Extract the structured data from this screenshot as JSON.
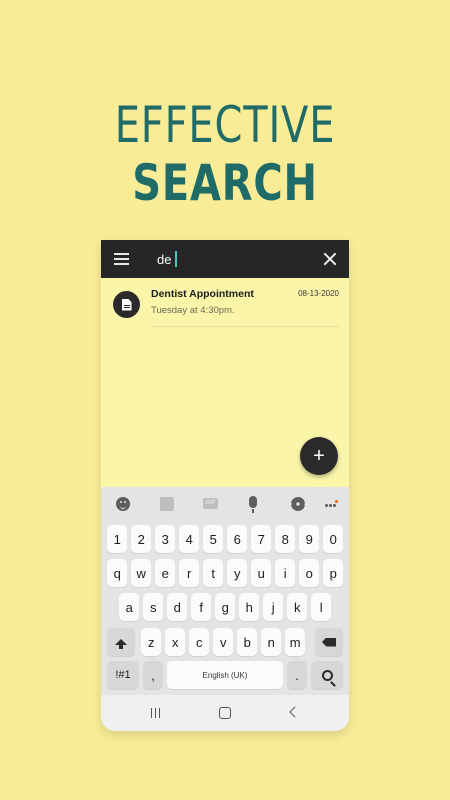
{
  "headline": {
    "line1": "EFFECTIVE",
    "line2": "SEARCH"
  },
  "search": {
    "value": "de",
    "menu_icon": "hamburger-menu-icon",
    "close_icon": "close-icon"
  },
  "results": [
    {
      "title": "Dentist Appointment",
      "subtitle": "Tuesday at 4:30pm.",
      "date": "08-13-2020",
      "icon": "document-icon"
    }
  ],
  "fab": {
    "label": "+"
  },
  "keyboard": {
    "toolbar": [
      "emoji-icon",
      "sticker-icon",
      "gif-icon",
      "mic-icon",
      "gear-icon",
      "more-icon"
    ],
    "gif_label": "GIF",
    "row_numbers": [
      "1",
      "2",
      "3",
      "4",
      "5",
      "6",
      "7",
      "8",
      "9",
      "0"
    ],
    "row_top": [
      "q",
      "w",
      "e",
      "r",
      "t",
      "y",
      "u",
      "i",
      "o",
      "p"
    ],
    "row_mid": [
      "a",
      "s",
      "d",
      "f",
      "g",
      "h",
      "j",
      "k",
      "l"
    ],
    "row_bottom": [
      "z",
      "x",
      "c",
      "v",
      "b",
      "n",
      "m"
    ],
    "symbols_label": "!#1",
    "comma_label": ",",
    "space_label": "English (UK)",
    "period_label": "."
  },
  "colors": {
    "background": "#f8ec97",
    "headline": "#1f6b67",
    "note_bg": "#faf5a9",
    "bar": "#262626"
  }
}
